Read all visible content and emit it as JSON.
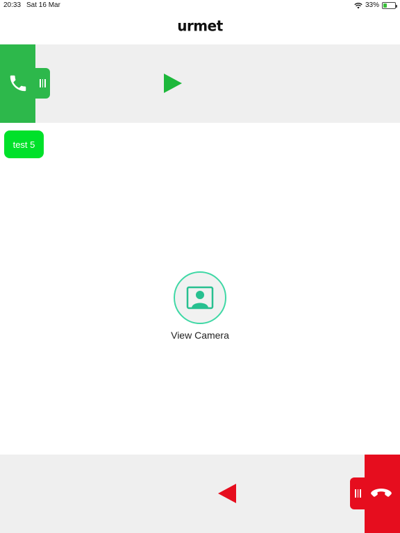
{
  "status_bar": {
    "time": "20:33",
    "date": "Sat 16 Mar",
    "battery_percent": "33%",
    "battery_level": 0.33,
    "wifi_icon": "wifi-icon",
    "battery_icon": "battery-charging-icon"
  },
  "header": {
    "logo_text": "urmet"
  },
  "answer_panel": {
    "color": "#2db84b",
    "phone_icon": "phone-icon",
    "grip_icon": "grip-icon",
    "arrow_icon": "play-arrow-icon",
    "arrow_color": "#1db83b"
  },
  "tag": {
    "label": "test 5",
    "color": "#00e12a"
  },
  "camera": {
    "label": "View Camera",
    "icon": "camera-portrait-icon",
    "ring_color": "#3fd8a5"
  },
  "hangup_panel": {
    "color": "#e60d1e",
    "hangup_icon": "hangup-phone-icon",
    "grip_icon": "grip-icon",
    "arrow_icon": "back-arrow-icon"
  }
}
